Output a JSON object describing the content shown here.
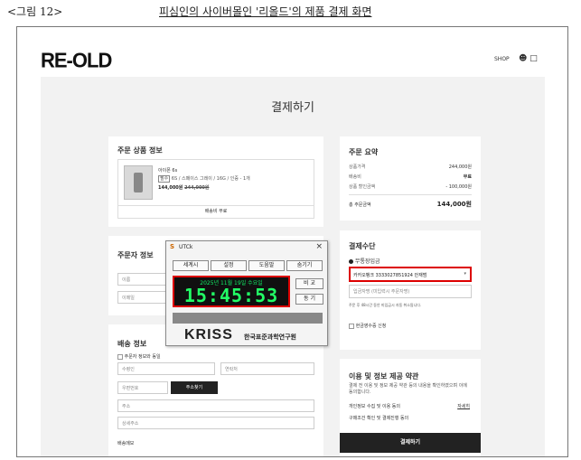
{
  "document": {
    "figure_label": "<그림 12>",
    "figure_title": "피심인의 사이버몰인 '리올드'의 제품 결제 화면"
  },
  "header": {
    "logo": "RE-OLD",
    "shop": "SHOP",
    "icons": [
      "user-icon",
      "bag-icon"
    ]
  },
  "page_title": "결제하기",
  "order_items": {
    "heading": "주문 상품 정보",
    "product_name": "아이폰 6s",
    "option_tag": "필수",
    "option_text": "6S / 스페이스 그레이 / 16G / 인증 - 1개",
    "price": "144,000원",
    "original_price": "244,000원",
    "shipping": "배송비 무료"
  },
  "orderer": {
    "heading": "주문자 정보",
    "name_placeholder": "이름",
    "email_placeholder": "이메일"
  },
  "shipping_info": {
    "heading": "배송 정보",
    "same_as_orderer": "주문자 정보와 동일",
    "recipient_placeholder": "수령인",
    "contact_placeholder": "연락처",
    "zip_placeholder": "우편번호",
    "zip_button": "주소찾기",
    "address_placeholder": "주소",
    "detail_placeholder": "상세주소",
    "memo_label": "배송메모"
  },
  "summary": {
    "heading": "주문 요약",
    "rows": [
      {
        "label": "상품가격",
        "value": "244,000원"
      },
      {
        "label": "배송비",
        "value": "무료"
      },
      {
        "label": "상품 할인금액",
        "value": "- 100,000원"
      }
    ],
    "total_label": "총 주문금액",
    "total_value": "144,000원"
  },
  "payment": {
    "heading": "결제수단",
    "method": "무통장입금",
    "account": "카카오뱅크 3333027851924 안재범",
    "depositor_placeholder": "입금자명 (미입력시 주문자명)",
    "notice": "주문 후 48시간 동안 미입금시 자동 취소됩니다.",
    "receipt": "현금영수증 신청"
  },
  "terms": {
    "heading": "이용 및 정보 제공 약관",
    "desc": "결제 전 이용 및 정보 제공 약관 등의 내용을 확인하였으며 이에 동의합니다.",
    "privacy": "개인정보 수집 및 이용 동의",
    "privacy_link": "자세히",
    "purchase": "구매조건 확인 및 결제진행 동의",
    "pay_button": "결제하기"
  },
  "utck": {
    "title": "UTCk",
    "buttons": [
      "세계시",
      "설정",
      "도움말",
      "숨기기"
    ],
    "date": "2025년 11월 19일 수요일",
    "time": "15:45:53",
    "compare": "비 교",
    "sync": "동 기",
    "org_logo": "KRISS",
    "org_name": "한국표준과학연구원"
  },
  "colors": {
    "highlight": "#dd0000",
    "clock_text": "#22ff66",
    "dark": "#222222"
  }
}
